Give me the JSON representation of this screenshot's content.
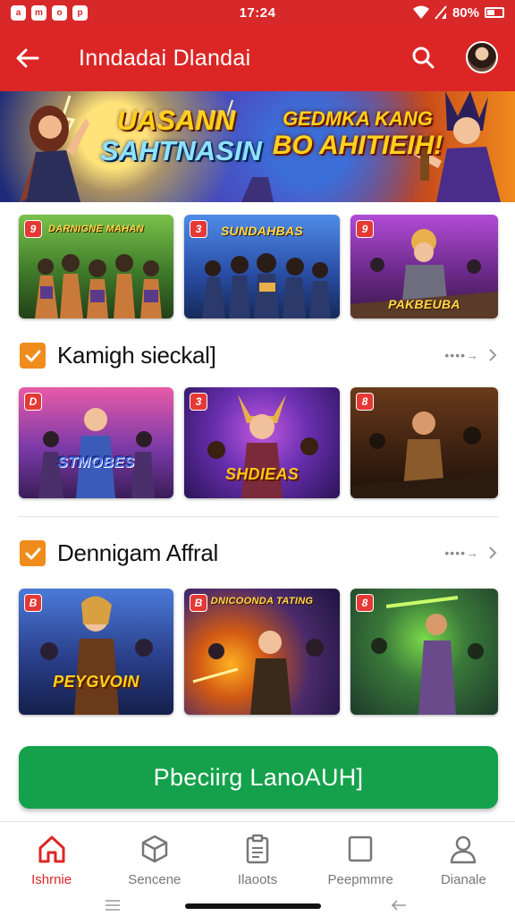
{
  "status_bar": {
    "time": "17:24",
    "battery": "80%",
    "app_icons": [
      "a",
      "m",
      "o",
      "p"
    ]
  },
  "app_bar": {
    "title": "Inndadai Dlandai",
    "back_icon": "arrow-left-icon",
    "search_icon": "search-icon"
  },
  "hero": {
    "left_title_line1": "UASANN",
    "left_title_line2": "SAHTNASIN",
    "right_title_line1": "GEDMKA KANG",
    "right_title_line2": "BO AHITIEIH!"
  },
  "featured_row": [
    {
      "badge": "9",
      "caption": "",
      "top_caption": "DARNIGNE MAHAN",
      "theme": "green"
    },
    {
      "badge": "3",
      "caption": "",
      "top_caption": "SUNDAHBAS",
      "theme": "blue"
    },
    {
      "badge": "9",
      "caption": "PAKBEUBA",
      "top_caption": "",
      "theme": "purple"
    }
  ],
  "sections": [
    {
      "title": "Kamigh sieckal]",
      "more_label": "••••→",
      "tiles": [
        {
          "badge": "D",
          "caption": "STMOBES",
          "theme": "pink"
        },
        {
          "badge": "3",
          "caption": "SHDIEAS",
          "theme": "violet"
        },
        {
          "badge": "8",
          "caption": "",
          "theme": "brown"
        }
      ]
    },
    {
      "title": "Dennigam Affral",
      "more_label": "••••→",
      "tiles": [
        {
          "badge": "B",
          "caption": "PEYGVOIN",
          "theme": "blue2"
        },
        {
          "badge": "B",
          "caption": "",
          "top_caption": "DNICOONDA TATING",
          "theme": "fire"
        },
        {
          "badge": "8",
          "caption": "",
          "theme": "forest"
        }
      ]
    }
  ],
  "cta": {
    "label": "Pbeciirg LanoAUH]"
  },
  "bottom_nav": [
    {
      "label": "Ishrnie",
      "icon": "home-icon",
      "active": true
    },
    {
      "label": "Sencene",
      "icon": "cube-icon",
      "active": false
    },
    {
      "label": "Ilaoots",
      "icon": "clipboard-icon",
      "active": false
    },
    {
      "label": "Peepmmre",
      "icon": "square-icon",
      "active": false
    },
    {
      "label": "Dianale",
      "icon": "person-icon",
      "active": false
    }
  ],
  "colors": {
    "brand_red": "#dc2626",
    "accent_orange": "#f08c1c",
    "cta_green": "#15a14b",
    "badge_red": "#e53935"
  }
}
